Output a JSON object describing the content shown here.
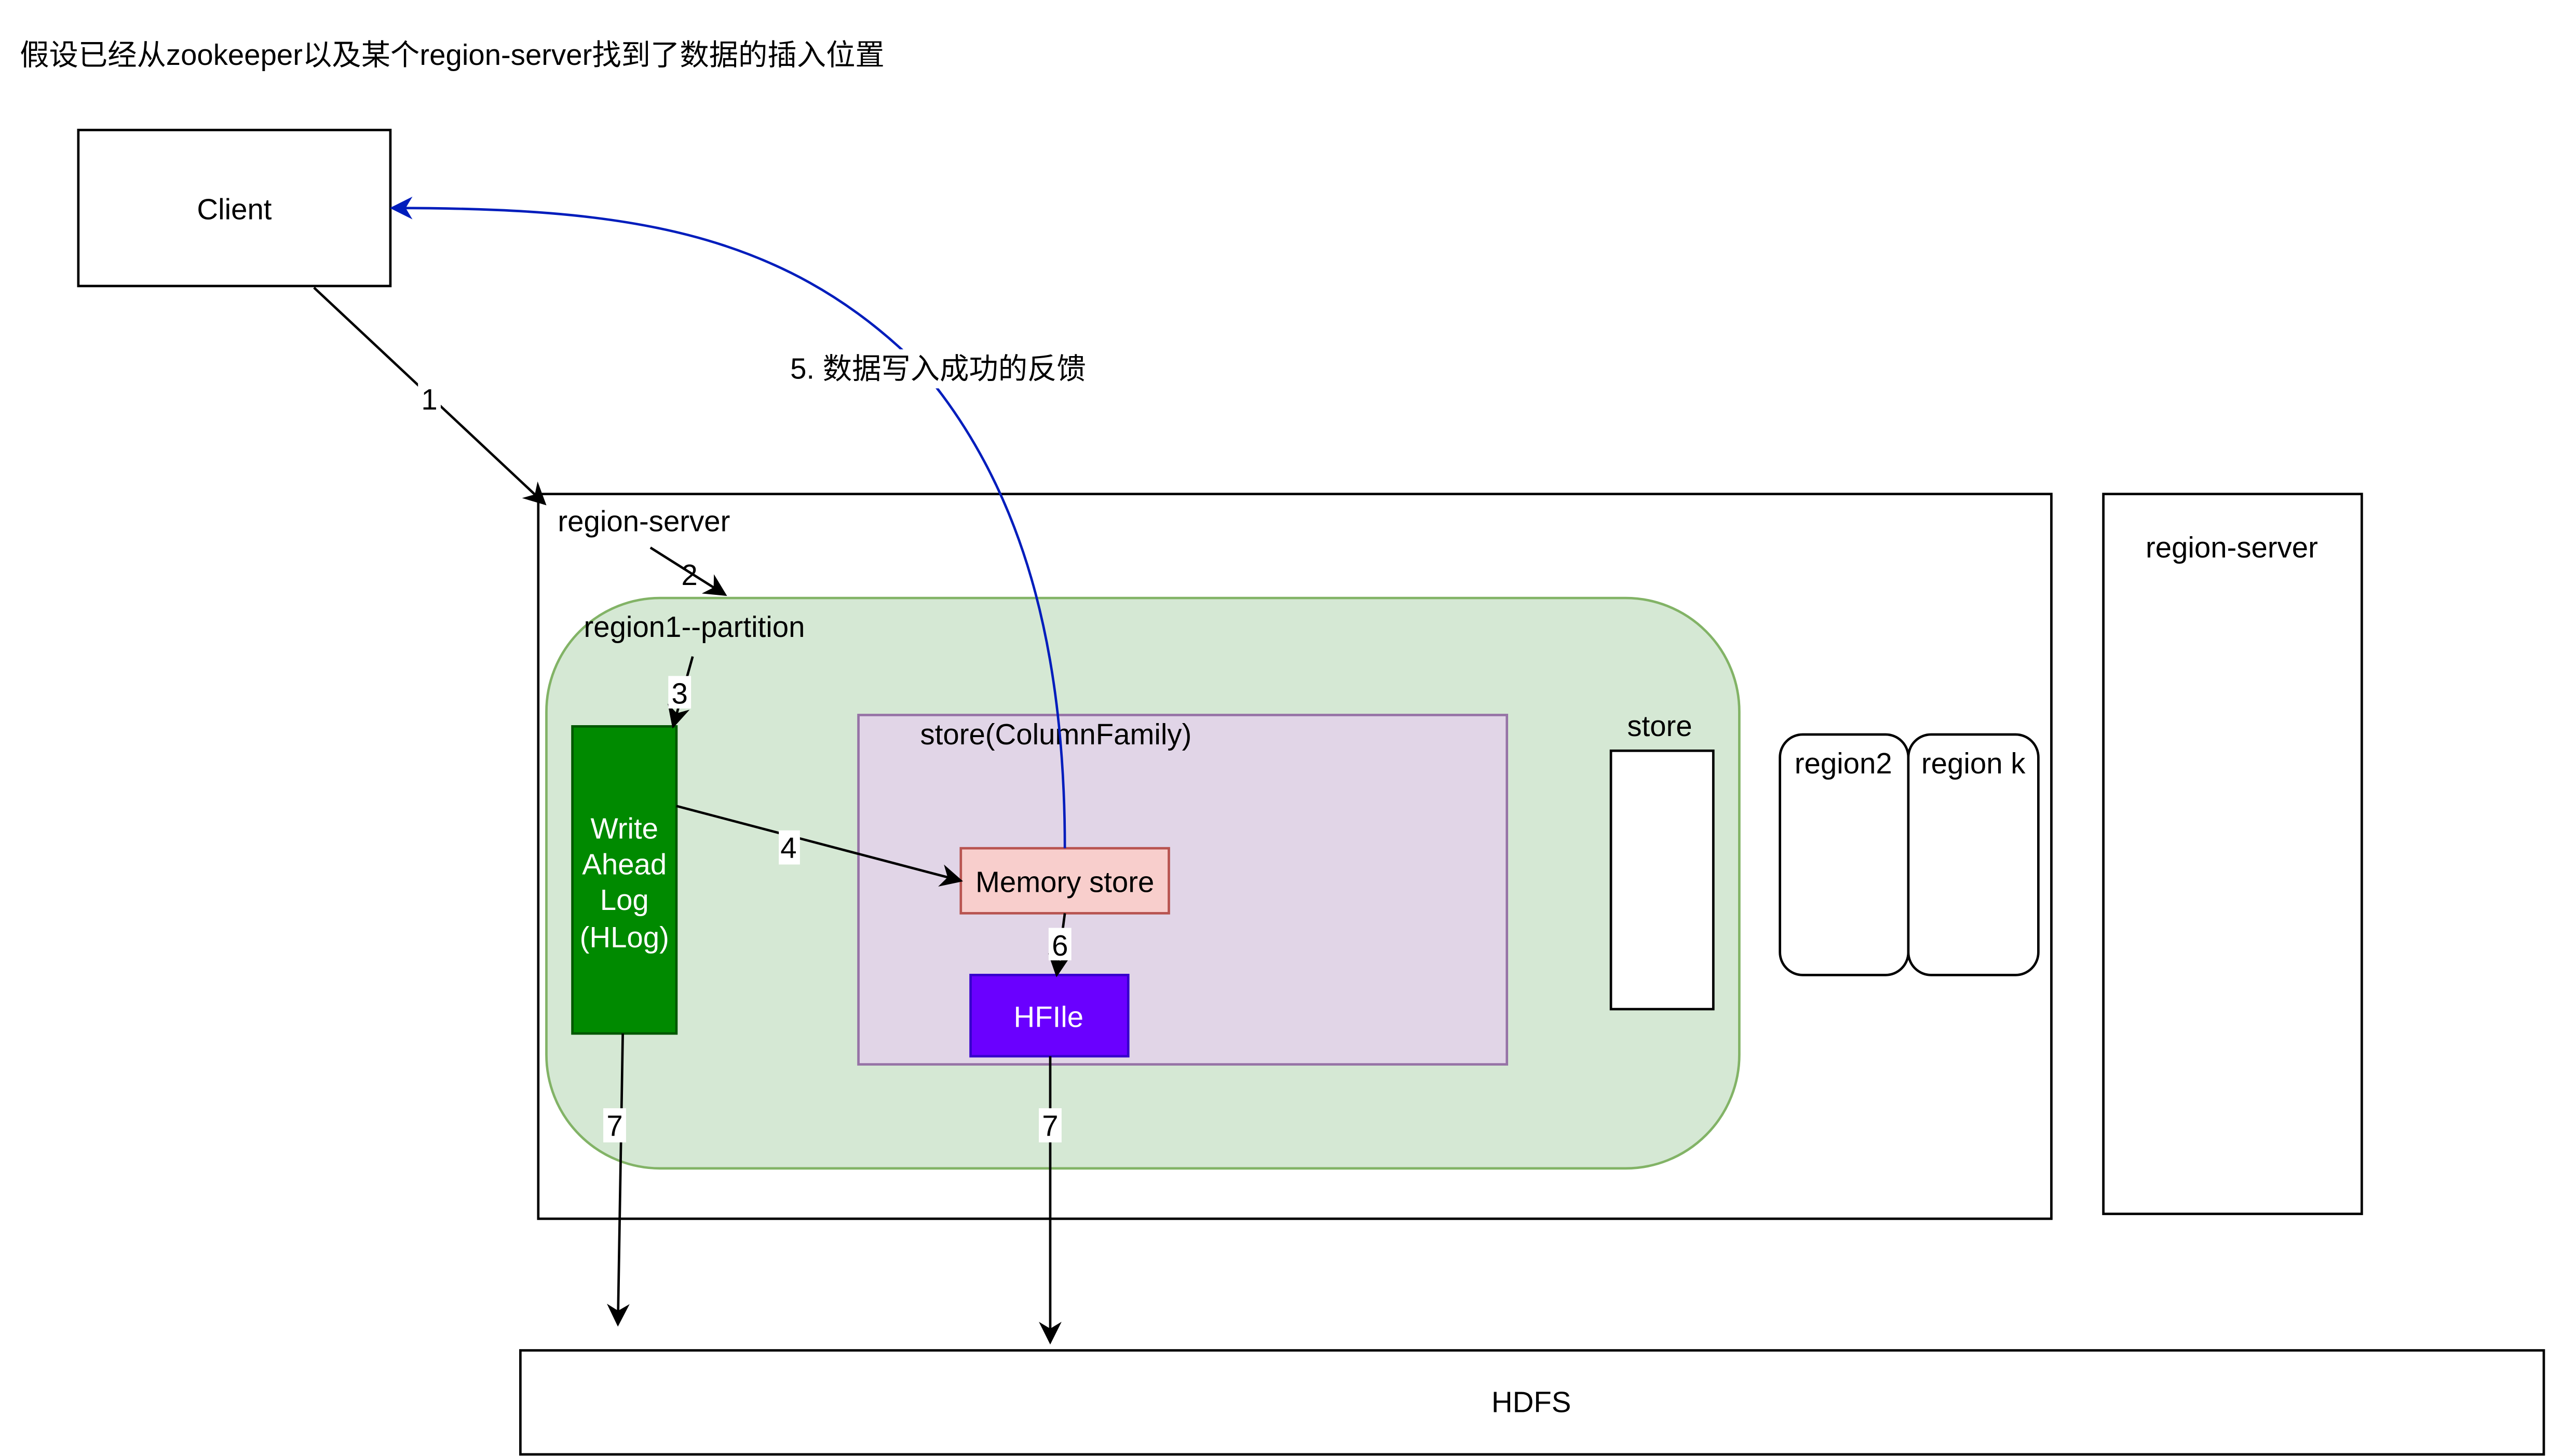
{
  "title": "假设已经从zookeeper以及某个region-server找到了数据的插入位置",
  "nodes": {
    "client": "Client",
    "region_server_main": "region-server",
    "region1": "region1--partition",
    "wal": [
      "Write",
      "Ahead",
      "Log",
      "(HLog)"
    ],
    "store_cf": "store(ColumnFamily)",
    "memory_store": "Memory store",
    "hfile": "HFIle",
    "store": "store",
    "region2": "region2",
    "region_k": "region k",
    "region_server_other": "region-server",
    "hdfs": "HDFS"
  },
  "edges": {
    "e1": "1",
    "e2": "2",
    "e3": "3",
    "e4": "4",
    "e5": "5. 数据写入成功的反馈",
    "e6": "6",
    "e7a": "7",
    "e7b": "7"
  },
  "colors": {
    "region_fill": "#d5e8d4",
    "region_stroke": "#82b366",
    "wal_fill": "#008a00",
    "wal_stroke": "#005700",
    "store_fill": "#e1d5e7",
    "store_stroke": "#9673a6",
    "memstore_fill": "#f8cecc",
    "memstore_stroke": "#b85450",
    "hfile_fill": "#6a00ff",
    "hfile_stroke": "#3700cc",
    "feedback_arrow": "#001dbc"
  }
}
